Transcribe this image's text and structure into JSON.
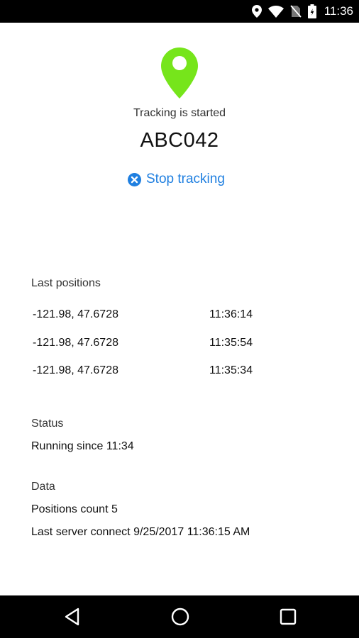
{
  "status_bar": {
    "time": "11:36",
    "icons": [
      "location-icon",
      "wifi-icon",
      "no-sim-icon",
      "battery-icon"
    ]
  },
  "header": {
    "icon": "map-pin-icon",
    "accent_color": "#76e51b",
    "tracking_state": "Tracking is started",
    "device_id": "ABC042",
    "stop_label": "Stop tracking",
    "stop_color": "#1f7fe0"
  },
  "positions": {
    "title": "Last positions",
    "rows": [
      {
        "coords": "-121.98, 47.6728",
        "time": "11:36:14"
      },
      {
        "coords": "-121.98, 47.6728",
        "time": "11:35:54"
      },
      {
        "coords": "-121.98, 47.6728",
        "time": "11:35:34"
      }
    ]
  },
  "status": {
    "title": "Status",
    "text": "Running since  11:34"
  },
  "data_section": {
    "title": "Data",
    "positions_count": "Positions count  5",
    "last_server_connect": "Last server connect  9/25/2017 11:36:15 AM"
  },
  "nav": {
    "buttons": [
      "back-icon",
      "home-icon",
      "recents-icon"
    ]
  }
}
